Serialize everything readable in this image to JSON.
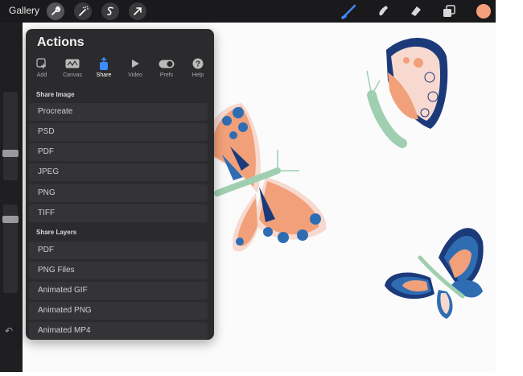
{
  "topbar": {
    "gallery_label": "Gallery",
    "left_tools": [
      "wrench-icon",
      "magic-wand-icon",
      "selection-s-icon",
      "transform-arrow-icon"
    ],
    "right_tools": [
      "brush-icon",
      "smudge-icon",
      "eraser-icon",
      "layers-icon"
    ],
    "current_color": "#f5a07a"
  },
  "actions": {
    "title": "Actions",
    "tabs": [
      {
        "label": "Add",
        "icon": "add-icon"
      },
      {
        "label": "Canvas",
        "icon": "canvas-icon"
      },
      {
        "label": "Share",
        "icon": "share-icon"
      },
      {
        "label": "Video",
        "icon": "play-icon"
      },
      {
        "label": "Prefs",
        "icon": "toggle-icon"
      },
      {
        "label": "Help",
        "icon": "help-icon"
      }
    ],
    "active_tab": "Share",
    "share_image": {
      "heading": "Share Image",
      "items": [
        "Procreate",
        "PSD",
        "PDF",
        "JPEG",
        "PNG",
        "TIFF"
      ]
    },
    "share_layers": {
      "heading": "Share Layers",
      "items": [
        "PDF",
        "PNG Files",
        "Animated GIF",
        "Animated PNG",
        "Animated MP4"
      ]
    }
  },
  "colors": {
    "toolbar_bg": "#1a1a1c",
    "panel_bg": "#2b2b2d",
    "accent_blue": "#3d8bff",
    "butterfly_peach": "#f2a07a",
    "butterfly_navy": "#1c3a7a",
    "butterfly_blue": "#2f6db3",
    "butterfly_green": "#9fcfb0"
  }
}
